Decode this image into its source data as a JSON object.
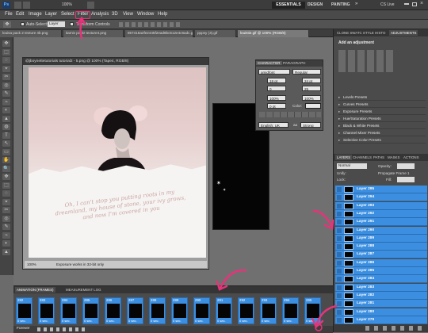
{
  "app": {
    "logo": "Ps",
    "zoom": "100%",
    "essentials": "ESSENTIALS",
    "design": "DESIGN",
    "painting": "PAINTING",
    "more": "»",
    "cs_live": "CS Live"
  },
  "menu": [
    "File",
    "Edit",
    "Image",
    "Layer",
    "Select",
    "Filter",
    "Analysis",
    "3D",
    "View",
    "Window",
    "Help"
  ],
  "options": {
    "auto_select": "Auto-Select:",
    "auto_select_value": "Layer",
    "transform": "Transform Controls"
  },
  "tabs": [
    "louisa pack 2 texture 4b.png",
    "itamiv pack! texture4.png",
    "857416a2fe2445f2ead8bc512e4c6adc.gif",
    "pppsy (3).gif",
    "louistie.gif @ 100% (RGB/8)"
  ],
  "doc": {
    "title": "@jboynettetutorials tutorial2 - 5.png @ 100% (Tape4, RGB/8)",
    "zoom": "100%",
    "status": "Exposure works in 32-bit only",
    "quote": "Oh, I can't stop you putting roots in my dreamland, my house of stone, your ivy grows, and now I'm covered in you"
  },
  "character": {
    "tab_character": "CHARACTER",
    "tab_paragraph": "PARAGRAPH",
    "font": "amidfont",
    "style": "Regular",
    "size": "18 pt",
    "leading": "24 pt",
    "kerning": "0",
    "tracking": "25",
    "vscale": "100%",
    "hscale": "100%",
    "baseline": "0 pt",
    "color_label": "Color:",
    "language": "English: UK",
    "aa": "aa",
    "antialias": "Strong"
  },
  "adjustments": {
    "tabs": [
      "CLONE SWATC STYLE HISTO",
      "ADJUSTMENTS"
    ],
    "heading": "Add an adjustment",
    "presets": [
      "Levels Presets",
      "Curves Presets",
      "Exposure Presets",
      "Hue/Saturation Presets",
      "Black & White Presets",
      "Channel Mixer Presets",
      "Selective Color Presets"
    ]
  },
  "layers": {
    "tabs": [
      "LAYERS",
      "CHANNELS",
      "PATHS",
      "MASKS",
      "ACTIONS"
    ],
    "blend": "Normal",
    "opacity": "Opacity:",
    "fill": "Fill:",
    "unify": "Unify:",
    "propagate": "Propagate Frame 1",
    "lock": "Lock:",
    "rows": [
      "Layer 295",
      "Layer 294",
      "Layer 293",
      "Layer 292",
      "Layer 291",
      "Layer 290",
      "Layer 289",
      "Layer 288",
      "Layer 287",
      "Layer 286",
      "Layer 285",
      "Layer 284",
      "Layer 283",
      "Layer 282",
      "Layer 281",
      "Layer 280",
      "Layer 279"
    ]
  },
  "animation": {
    "tabs": [
      "ANIMATION (FRAMES)",
      "MEASUREMENT LOG"
    ],
    "frames": [
      "282",
      "283",
      "284",
      "285",
      "286",
      "287",
      "288",
      "289",
      "290",
      "291",
      "292",
      "293",
      "294",
      "295"
    ],
    "frame_time": "0 sec.",
    "loop": "Forever"
  },
  "colors": {
    "accent": "#e6337a",
    "layer_selected": "#3c8fe0"
  }
}
